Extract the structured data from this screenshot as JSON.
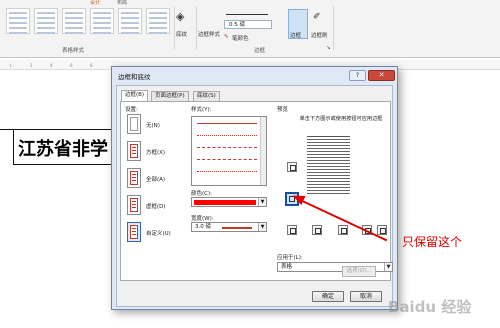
{
  "ribbon": {
    "tabs": [
      "设计",
      "布局"
    ],
    "group_table_styles": "表格样式",
    "shading_label": "底纹",
    "border_styles_label": "边框样式",
    "line_weight": "0.5 磅",
    "pen_color_label": "笔颜色",
    "borders_label": "边框",
    "border_painter_label": "边框刷",
    "group_borders": "边框"
  },
  "document": {
    "cell_text": "江苏省非学"
  },
  "dialog": {
    "title": "边框和底纹",
    "help": "?",
    "close": "✕",
    "tabs": [
      "边框(B)",
      "页面边框(P)",
      "底纹(S)"
    ],
    "setting_label": "设置:",
    "settings": [
      "无(N)",
      "方框(X)",
      "全部(A)",
      "虚框(D)",
      "自定义(U)"
    ],
    "style_label": "样式(Y):",
    "color_label": "颜色(C):",
    "color_value": "#ff0000",
    "width_label": "宽度(W):",
    "width_value": "3.0 磅",
    "preview_label": "预览",
    "preview_hint": "单击下方图示或使用按钮可应用边框",
    "apply_label": "应用于(L):",
    "apply_value": "表格",
    "options_button": "选项(O)...",
    "ok_button": "确定",
    "cancel_button": "取消"
  },
  "annotation": {
    "text": "只保留这个",
    "color": "#e00000"
  },
  "watermark": {
    "text": "Baidu 经验"
  }
}
